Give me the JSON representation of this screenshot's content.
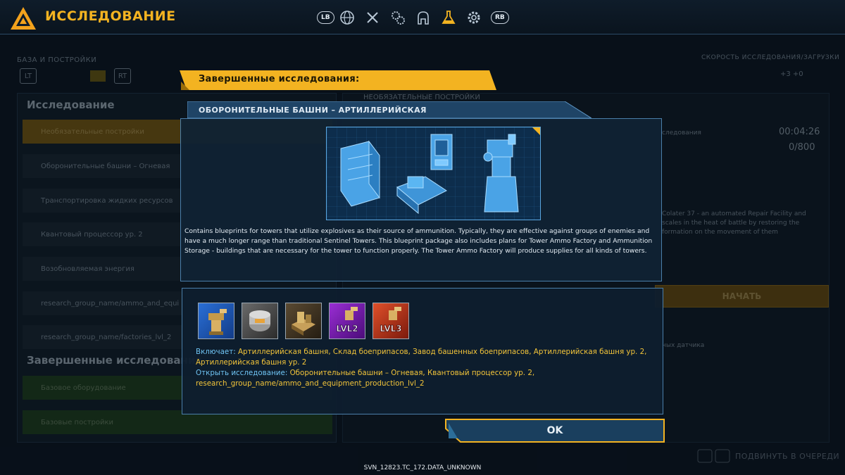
{
  "header": {
    "title": "ИССЛЕДОВАНИЕ",
    "lb": "LB",
    "rb": "RB",
    "tabs": [
      "globe-icon",
      "pickaxe-icon",
      "gears-icon",
      "robot-icon",
      "flask-icon",
      "cog-icon"
    ]
  },
  "background": {
    "section_label": "БАЗА И ПОСТРОЙКИ",
    "lt": "LT",
    "rt": "RT",
    "research_heading": "Исследование",
    "research_items": [
      "Необязательные постройки",
      "Оборонительные башни – Огневая",
      "Транспортировка жидких ресурсов",
      "Квантовый процессор ур. 2",
      "Возобновляемая энергия",
      "research_group_name/ammo_and_equi",
      "research_group_name/factories_lvl_2"
    ],
    "done_heading": "Завершенные исследования",
    "done_items": [
      "Базовое оборудование",
      "Базовые постройки"
    ],
    "upcoming": "НЕОБЯЗАТЕЛЬНЫЕ ПОСТРОЙКИ",
    "speed_label": "СКОРОСТЬ ИССЛЕДОВАНИЯ/ЗАГРУЗКИ",
    "speed_values": "+3   +0",
    "research_label": "следования",
    "timer": "00:04:26",
    "progress": "0/800",
    "desc": "Colater 37 - an automated Repair Facility and scales in the heat of battle by restoring the formation on the movement of them",
    "start": "НАЧАТЬ",
    "sensor": "ных датчика",
    "queue": "ПОДВИНУТЬ В ОЧЕРЕДИ"
  },
  "modal": {
    "heading": "Завершенные исследования:",
    "subheading": "ОБОРОНИТЕЛЬНЫЕ БАШНИ – АРТИЛЛЕРИЙСКАЯ",
    "description": "Contains blueprints for towers that utilize explosives as their source of ammunition. Typically, they are effective against groups of enemies and have a much longer range than traditional Sentinel Towers.  This blueprint package also includes plans for Tower Ammo Factory and Ammunition Storage - buildings that are necessary for the tower to function properly. The Tower Ammo Factory will produce supplies for all kinds of towers.",
    "slots": [
      {
        "name": "artillery-tower",
        "bg": "#1a4fb0",
        "badge": ""
      },
      {
        "name": "ammo-storage",
        "bg": "#4a4a4a",
        "badge": ""
      },
      {
        "name": "tower-ammo-factory",
        "bg": "#3d3426",
        "badge": ""
      },
      {
        "name": "artillery-tower-lvl2",
        "bg": "#6b1fa0",
        "badge": "LVL2"
      },
      {
        "name": "artillery-tower-lvl3",
        "bg": "#b0301a",
        "badge": "LVL3"
      }
    ],
    "includes_label": "Включает:",
    "includes_value": "Артиллерийская башня, Склад боеприпасов, Завод башенных боеприпасов, Артиллерийская башня ур. 2, Артиллерийская башня ур. 2",
    "unlock_label": "Открыть исследование:",
    "unlock_value": "Оборонительные башни – Огневая, Квантовый процессор ур. 2, research_group_name/ammo_and_equipment_production_lvl_2",
    "ok": "OK",
    "accent": "#f3b321"
  },
  "footer": "SVN_12823.TC_172.DATA_UNKNOWN"
}
